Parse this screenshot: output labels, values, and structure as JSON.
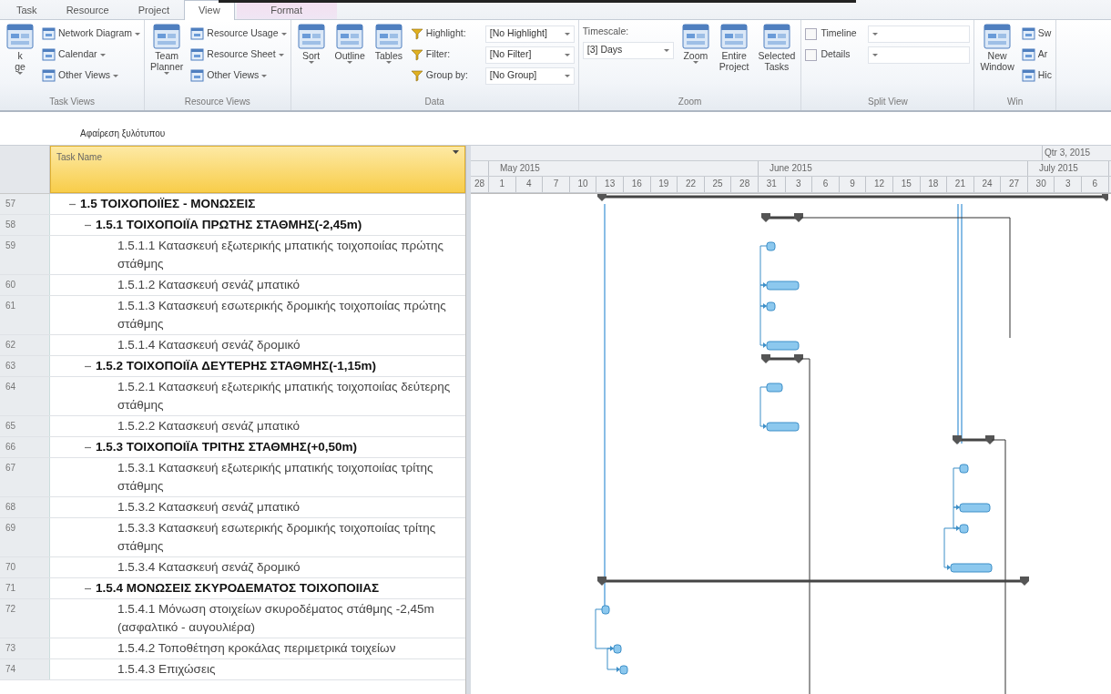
{
  "tabs": [
    {
      "label": "Task",
      "selected": false,
      "kind": "normal"
    },
    {
      "label": "Resource",
      "selected": false,
      "kind": "normal"
    },
    {
      "label": "Project",
      "selected": false,
      "kind": "normal"
    },
    {
      "label": "View",
      "selected": true,
      "kind": "normal"
    },
    {
      "label": "Format",
      "selected": false,
      "kind": "contextual"
    }
  ],
  "ribbon": {
    "groups": [
      {
        "label": "Task Views",
        "items": [
          {
            "kind": "large",
            "lines": [
              "k",
              "ge"
            ],
            "dropdown": true
          },
          {
            "kind": "small",
            "label": "Network Diagram",
            "dropdown": true
          },
          {
            "kind": "small",
            "label": "Calendar",
            "dropdown": true
          },
          {
            "kind": "small",
            "label": "Other Views",
            "dropdown": true
          }
        ]
      },
      {
        "label": "Resource Views",
        "items": [
          {
            "kind": "large",
            "lines": [
              "Team",
              "Planner"
            ],
            "dropdown": true
          },
          {
            "kind": "small",
            "label": "Resource Usage",
            "dropdown": true
          },
          {
            "kind": "small",
            "label": "Resource Sheet",
            "dropdown": true
          },
          {
            "kind": "small",
            "label": "Other Views",
            "dropdown": true
          }
        ]
      },
      {
        "label": "Data",
        "items": [
          {
            "kind": "large",
            "lines": [
              "Sort"
            ],
            "dropdown": true
          },
          {
            "kind": "large",
            "lines": [
              "Outline"
            ],
            "dropdown": true
          },
          {
            "kind": "large",
            "lines": [
              "Tables"
            ],
            "dropdown": true
          },
          {
            "kind": "combo",
            "label": "Highlight:",
            "value": "[No Highlight]"
          },
          {
            "kind": "combo",
            "label": "Filter:",
            "value": "[No Filter]"
          },
          {
            "kind": "combo",
            "label": "Group by:",
            "value": "[No Group]"
          }
        ]
      },
      {
        "label": "Zoom",
        "items": [
          {
            "kind": "timescale",
            "label": "Timescale:",
            "value": "[3] Days"
          },
          {
            "kind": "large",
            "lines": [
              "Zoom"
            ],
            "dropdown": true
          },
          {
            "kind": "large",
            "lines": [
              "Entire",
              "Project"
            ],
            "dropdown": false
          },
          {
            "kind": "large",
            "lines": [
              "Selected",
              "Tasks"
            ],
            "dropdown": false
          }
        ]
      },
      {
        "label": "Split View",
        "items": [
          {
            "kind": "check",
            "label": "Timeline",
            "checked": false
          },
          {
            "kind": "check",
            "label": "Details",
            "checked": false
          }
        ]
      },
      {
        "label": "Win",
        "items": [
          {
            "kind": "large",
            "lines": [
              "New",
              "Window"
            ],
            "dropdown": false
          },
          {
            "kind": "small",
            "label": "Sw",
            "dropdown": false
          },
          {
            "kind": "small",
            "label": "Ar",
            "dropdown": false
          },
          {
            "kind": "small",
            "label": "Hic",
            "dropdown": false
          }
        ]
      }
    ]
  },
  "entry_bar": {
    "value": "Αφαίρεση ξυλότυπου"
  },
  "table": {
    "columns": [
      {
        "label": "Task Name"
      }
    ],
    "rows": [
      {
        "id": "57",
        "name": "1.5 ΤΟΙΧΟΠΟΙΪΕΣ - ΜΟΝΩΣΕΙΣ",
        "expanded": true,
        "children": [
          {
            "id": "58",
            "name": "1.5.1 ΤΟΙΧΟΠΟΙΪΑ ΠΡΩΤΗΣ ΣΤΑΘΜΗΣ(-2,45m)",
            "expanded": true,
            "children": [
              {
                "id": "59",
                "name": "1.5.1.1 Κατασκευή εξωτερικής μπατικής τοιχοποιίας πρώτης στάθμης"
              },
              {
                "id": "60",
                "name": "1.5.1.2 Κατασκευή σενάζ μπατικό"
              },
              {
                "id": "61",
                "name": "1.5.1.3 Κατασκευή εσωτερικής δρομικής τοιχοποιίας πρώτης στάθμης"
              },
              {
                "id": "62",
                "name": "1.5.1.4 Κατασκευή σενάζ δρομικό"
              }
            ]
          },
          {
            "id": "63",
            "name": "1.5.2 ΤΟΙΧΟΠΟΙΪΑ ΔΕΥΤΕΡΗΣ ΣΤΑΘΜΗΣ(-1,15m)",
            "expanded": true,
            "children": [
              {
                "id": "64",
                "name": "1.5.2.1 Κατασκευή εξωτερικής μπατικής τοιχοποιίας δεύτερης στάθμης"
              },
              {
                "id": "65",
                "name": "1.5.2.2 Κατασκευή σενάζ μπατικό"
              }
            ]
          },
          {
            "id": "66",
            "name": "1.5.3 ΤΟΙΧΟΠΟΙΪΑ ΤΡΙΤΗΣ ΣΤΑΘΜΗΣ(+0,50m)",
            "expanded": true,
            "children": [
              {
                "id": "67",
                "name": "1.5.3.1 Κατασκευή εξωτερικής μπατικής τοιχοποιίας τρίτης στάθμης"
              },
              {
                "id": "68",
                "name": "1.5.3.2 Κατασκευή σενάζ μπατικό"
              },
              {
                "id": "69",
                "name": "1.5.3.3 Κατασκευή εσωτερικής δρομικής τοιχοποιίας τρίτης στάθμης"
              },
              {
                "id": "70",
                "name": "1.5.3.4 Κατασκευή σενάζ δρομικό"
              }
            ]
          },
          {
            "id": "71",
            "name": "1.5.4 ΜΟΝΩΣΕΙΣ ΣΚΥΡΟΔΕΜΑΤΟΣ ΤΟΙΧΟΠΟΙΙΑΣ",
            "expanded": true,
            "children": [
              {
                "id": "72",
                "name": "1.5.4.1 Μόνωση στοιχείων σκυροδέματος στάθμης -2,45m (ασφαλτικό - αυγουλιέρα)"
              },
              {
                "id": "73",
                "name": "1.5.4.2 Τοποθέτηση κροκάλας περιμετρικά τοιχείων"
              },
              {
                "id": "74",
                "name": "1.5.4.3 Επιχώσεις"
              }
            ]
          }
        ]
      }
    ]
  },
  "timescale": {
    "quarter": "Qtr 3, 2015",
    "months": [
      "May 2015",
      "June 2015",
      "July 2015"
    ],
    "days": [
      "28",
      "1",
      "4",
      "7",
      "10",
      "13",
      "16",
      "19",
      "22",
      "25",
      "28",
      "31",
      "3",
      "6",
      "9",
      "12",
      "15",
      "18",
      "21",
      "24",
      "27",
      "30",
      "3",
      "6"
    ]
  }
}
